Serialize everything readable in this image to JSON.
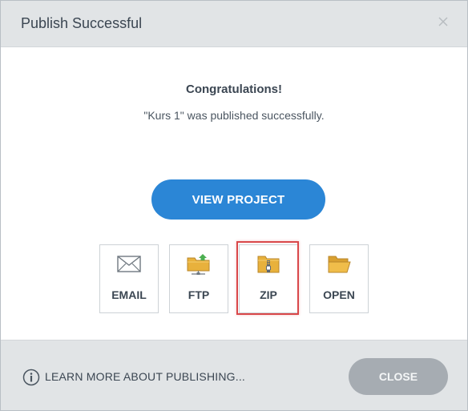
{
  "dialog": {
    "title": "Publish Successful",
    "close_icon": "close-icon"
  },
  "content": {
    "heading": "Congratulations!",
    "message": "\"Kurs 1\" was published successfully."
  },
  "primary_action": {
    "label": "VIEW PROJECT"
  },
  "actions": [
    {
      "label": "EMAIL",
      "icon": "envelope-icon"
    },
    {
      "label": "FTP",
      "icon": "folder-upload-icon"
    },
    {
      "label": "ZIP",
      "icon": "zip-folder-icon"
    },
    {
      "label": "OPEN",
      "icon": "folder-open-icon"
    }
  ],
  "footer": {
    "learn_more": "LEARN MORE ABOUT PUBLISHING...",
    "close_label": "CLOSE"
  },
  "colors": {
    "primary": "#2b86d6",
    "highlight": "#d9484a",
    "folder": "#e8b13c",
    "close_button": "#a6acb2"
  }
}
